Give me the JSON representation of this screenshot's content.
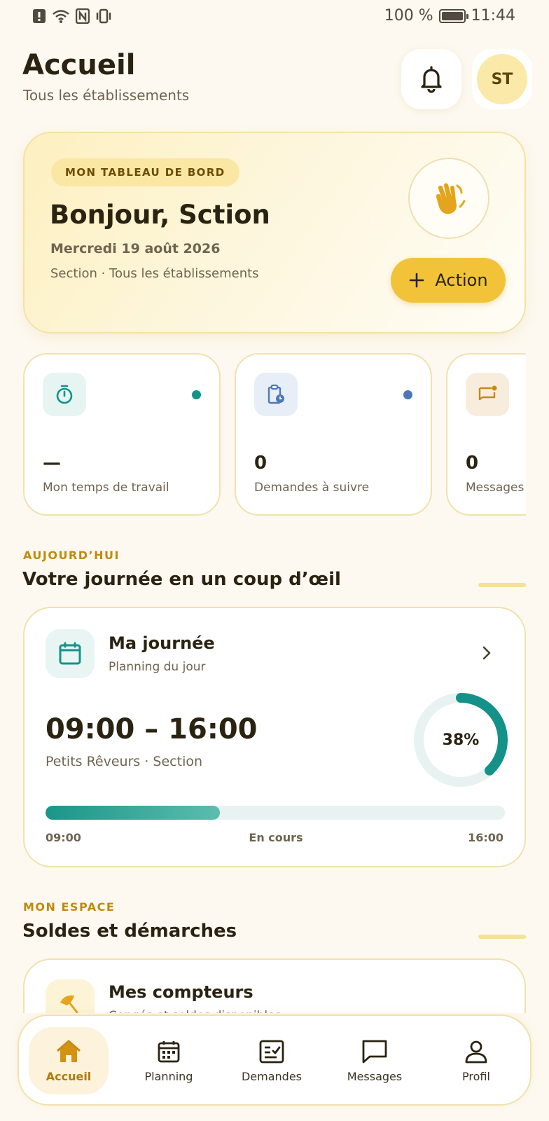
{
  "status_bar": {
    "battery": "100 %",
    "time": "11:44"
  },
  "header": {
    "title": "Accueil",
    "subtitle": "Tous les établissements",
    "avatar_initials": "ST"
  },
  "hero": {
    "badge": "MON TABLEAU DE BORD",
    "greeting": "Bonjour, Sction",
    "date": "Mercredi 19 août 2026",
    "context": "Section · Tous les établissements",
    "action_label": "Action"
  },
  "stats": [
    {
      "value": "—",
      "label": "Mon temps de travail",
      "icon": "timer-icon",
      "accent": "#14928a"
    },
    {
      "value": "0",
      "label": "Demandes à suivre",
      "icon": "clipboard-clock-icon",
      "accent": "#4d78b8"
    },
    {
      "value": "0",
      "label": "Messages",
      "icon": "message-badge-icon",
      "accent": "#c48a12"
    }
  ],
  "today": {
    "eyebrow": "AUJOURD’HUI",
    "title": "Votre journée en un coup d’œil"
  },
  "day_card": {
    "title": "Ma journée",
    "subtitle": "Planning du jour",
    "time_range": "09:00 – 16:00",
    "location": "Petits Rêveurs · Section",
    "progress_percent": 38,
    "progress_label": "38%",
    "start": "09:00",
    "status": "En cours",
    "end": "16:00"
  },
  "my_space": {
    "eyebrow": "MON ESPACE",
    "title": "Soldes et démarches"
  },
  "counters_card": {
    "title": "Mes compteurs",
    "subtitle": "Congés et soldes disponibles"
  },
  "nav": [
    {
      "label": "Accueil",
      "icon": "home-icon",
      "active": true
    },
    {
      "label": "Planning",
      "icon": "calendar-icon",
      "active": false
    },
    {
      "label": "Demandes",
      "icon": "checklist-icon",
      "active": false
    },
    {
      "label": "Messages",
      "icon": "chat-icon",
      "active": false
    },
    {
      "label": "Profil",
      "icon": "person-icon",
      "active": false
    }
  ],
  "colors": {
    "background": "#fdf9f0",
    "accent_yellow": "#f2c338",
    "teal": "#14928a",
    "brand_brown": "#b07a05"
  }
}
